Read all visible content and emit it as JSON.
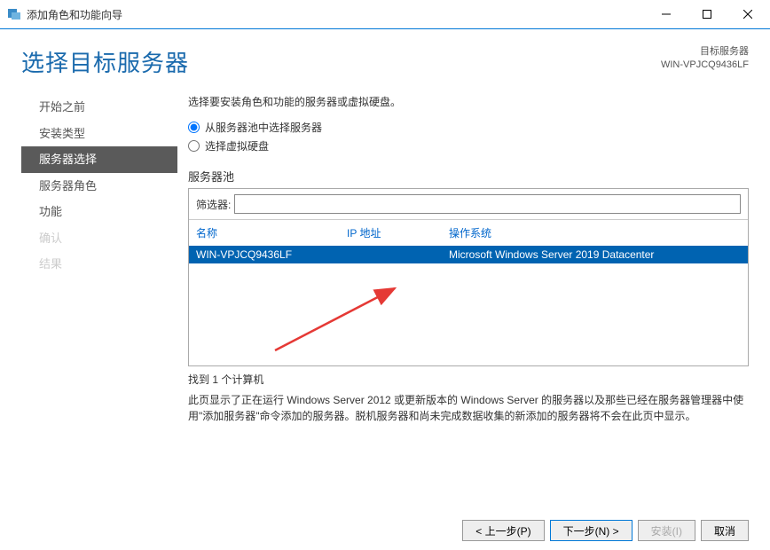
{
  "window": {
    "title": "添加角色和功能向导"
  },
  "header": {
    "title": "选择目标服务器",
    "target_label": "目标服务器",
    "target_server": "WIN-VPJCQ9436LF"
  },
  "sidebar": {
    "items": [
      {
        "label": "开始之前",
        "state": "normal"
      },
      {
        "label": "安装类型",
        "state": "normal"
      },
      {
        "label": "服务器选择",
        "state": "active"
      },
      {
        "label": "服务器角色",
        "state": "normal"
      },
      {
        "label": "功能",
        "state": "normal"
      },
      {
        "label": "确认",
        "state": "disabled"
      },
      {
        "label": "结果",
        "state": "disabled"
      }
    ]
  },
  "main": {
    "instruction": "选择要安装角色和功能的服务器或虚拟硬盘。",
    "radio": {
      "option_pool": "从服务器池中选择服务器",
      "option_vhd": "选择虚拟硬盘"
    },
    "pool_label": "服务器池",
    "filter_label": "筛选器:",
    "filter_value": "",
    "columns": {
      "name": "名称",
      "ip": "IP 地址",
      "os": "操作系统"
    },
    "rows": [
      {
        "name": "WIN-VPJCQ9436LF",
        "ip": "",
        "os": "Microsoft Windows Server 2019 Datacenter"
      }
    ],
    "found_count": "找到 1 个计算机",
    "description": "此页显示了正在运行 Windows Server 2012 或更新版本的 Windows Server 的服务器以及那些已经在服务器管理器中使用\"添加服务器\"命令添加的服务器。脱机服务器和尚未完成数据收集的新添加的服务器将不会在此页中显示。"
  },
  "footer": {
    "prev": "< 上一步(P)",
    "next": "下一步(N) >",
    "install": "安装(I)",
    "cancel": "取消"
  }
}
